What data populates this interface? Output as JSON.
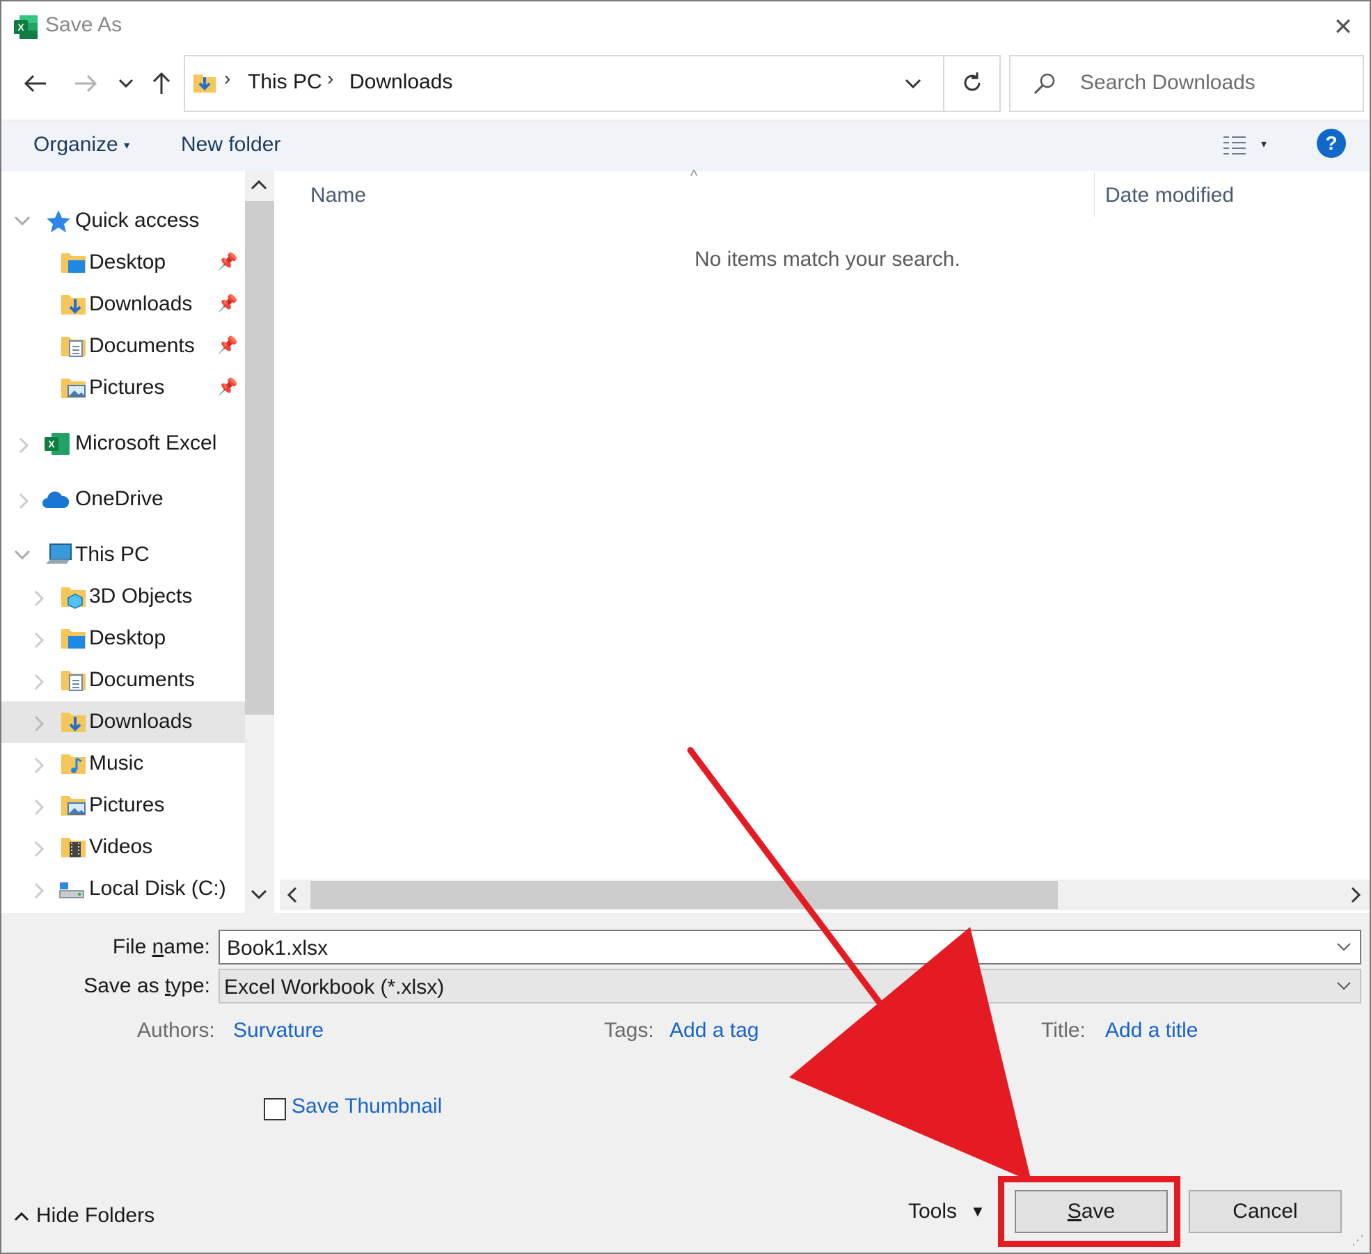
{
  "window": {
    "title": "Save As",
    "app_icon": "excel-icon",
    "close_icon": "close-icon"
  },
  "nav": {
    "back_icon": "back-arrow-icon",
    "forward_icon": "forward-arrow-icon",
    "recent_icon": "chevron-down-icon",
    "up_icon": "up-arrow-icon",
    "breadcrumb": [
      "This PC",
      "Downloads"
    ],
    "refresh_icon": "refresh-icon",
    "search_placeholder": "Search Downloads"
  },
  "toolbar": {
    "organize": "Organize",
    "new_folder": "New folder",
    "view_icon": "details-view-icon",
    "help_label": "?"
  },
  "sidebar": {
    "items": [
      {
        "label": "Quick access",
        "icon": "star-icon",
        "level": 0,
        "expanded": true
      },
      {
        "label": "Desktop",
        "icon": "desktop-folder-icon",
        "level": 1,
        "pinned": true
      },
      {
        "label": "Downloads",
        "icon": "downloads-folder-icon",
        "level": 1,
        "pinned": true
      },
      {
        "label": "Documents",
        "icon": "documents-folder-icon",
        "level": 1,
        "pinned": true
      },
      {
        "label": "Pictures",
        "icon": "pictures-folder-icon",
        "level": 1,
        "pinned": true
      },
      {
        "label": "Microsoft Excel",
        "icon": "excel-icon",
        "level": 0,
        "expanded": false
      },
      {
        "label": "OneDrive",
        "icon": "onedrive-icon",
        "level": 0,
        "expanded": false
      },
      {
        "label": "This PC",
        "icon": "computer-icon",
        "level": 0,
        "expanded": true
      },
      {
        "label": "3D Objects",
        "icon": "3d-objects-folder-icon",
        "level": 1
      },
      {
        "label": "Desktop",
        "icon": "desktop-folder-icon",
        "level": 1
      },
      {
        "label": "Documents",
        "icon": "documents-folder-icon",
        "level": 1
      },
      {
        "label": "Downloads",
        "icon": "downloads-folder-icon",
        "level": 1,
        "selected": true
      },
      {
        "label": "Music",
        "icon": "music-folder-icon",
        "level": 1
      },
      {
        "label": "Pictures",
        "icon": "pictures-folder-icon",
        "level": 1
      },
      {
        "label": "Videos",
        "icon": "videos-folder-icon",
        "level": 1
      },
      {
        "label": "Local Disk (C:)",
        "icon": "drive-icon",
        "level": 1
      }
    ]
  },
  "filelist": {
    "columns": [
      "Name",
      "Date modified"
    ],
    "empty_message": "No items match your search."
  },
  "form": {
    "file_name_label_pre": "File ",
    "file_name_label_u": "n",
    "file_name_label_post": "ame:",
    "file_name_value": "Book1.xlsx",
    "save_type_label_pre": "Save as ",
    "save_type_label_u": "t",
    "save_type_label_post": "ype:",
    "save_type_value": "Excel Workbook (*.xlsx)",
    "authors_label": "Authors:",
    "authors_value": "Survature",
    "tags_label": "Tags:",
    "tags_value": "Add a tag",
    "title_label": "Title:",
    "title_value": "Add a title",
    "save_thumbnail_label": "Save Thumbnail",
    "save_thumbnail_checked": false
  },
  "footer": {
    "hide_folders": "Hide Folders",
    "tools": "Tools",
    "save_u": "S",
    "save_rest": "ave",
    "cancel": "Cancel"
  },
  "annotation": {
    "color": "#e51b24",
    "target": "save-button"
  }
}
